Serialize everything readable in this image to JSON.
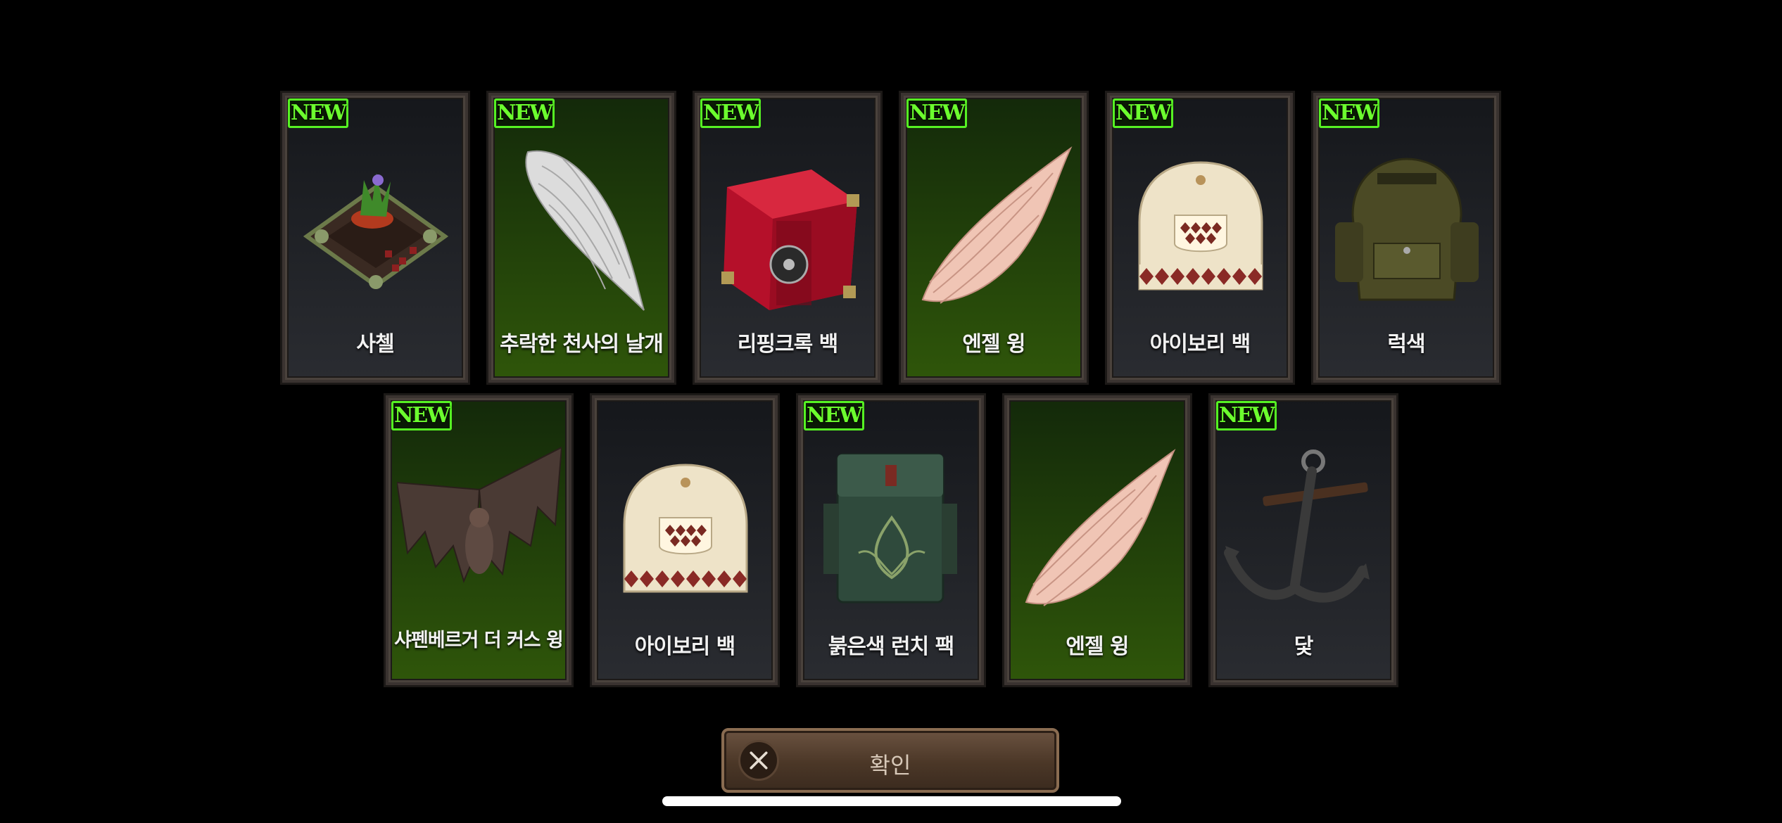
{
  "badge_text": "NEW",
  "colors": {
    "green_card": "#2f560a",
    "dark_card": "#2a2c31",
    "badge_green": "#56f223",
    "button_brown": "#4b3727"
  },
  "rows": [
    [
      {
        "name": "사첼",
        "new": true,
        "bg": "dark",
        "icon": "satchel-icon"
      },
      {
        "name": "추락한 천사의 날개",
        "new": true,
        "bg": "green",
        "icon": "white-wing-icon"
      },
      {
        "name": "리핑크록 백",
        "new": true,
        "bg": "dark",
        "icon": "red-bag-icon"
      },
      {
        "name": "엔젤 윙",
        "new": true,
        "bg": "green",
        "icon": "angel-wing-icon"
      },
      {
        "name": "아이보리 백",
        "new": true,
        "bg": "dark",
        "icon": "ivory-bag-icon"
      },
      {
        "name": "럭색",
        "new": true,
        "bg": "dark",
        "icon": "rucksack-icon"
      }
    ],
    [
      {
        "name": "샤펜베르거 더 커스 윙",
        "new": true,
        "bg": "green",
        "icon": "bat-wing-icon"
      },
      {
        "name": "아이보리 백",
        "new": false,
        "bg": "dark",
        "icon": "ivory-bag-icon"
      },
      {
        "name": "붉은색 런치 팩",
        "new": true,
        "bg": "dark",
        "icon": "green-pack-icon"
      },
      {
        "name": "엔젤 윙",
        "new": false,
        "bg": "green",
        "icon": "angel-wing-icon"
      },
      {
        "name": "닻",
        "new": true,
        "bg": "dark",
        "icon": "anchor-icon"
      }
    ]
  ],
  "confirm_button": {
    "label": "확인",
    "icon": "close-icon"
  }
}
